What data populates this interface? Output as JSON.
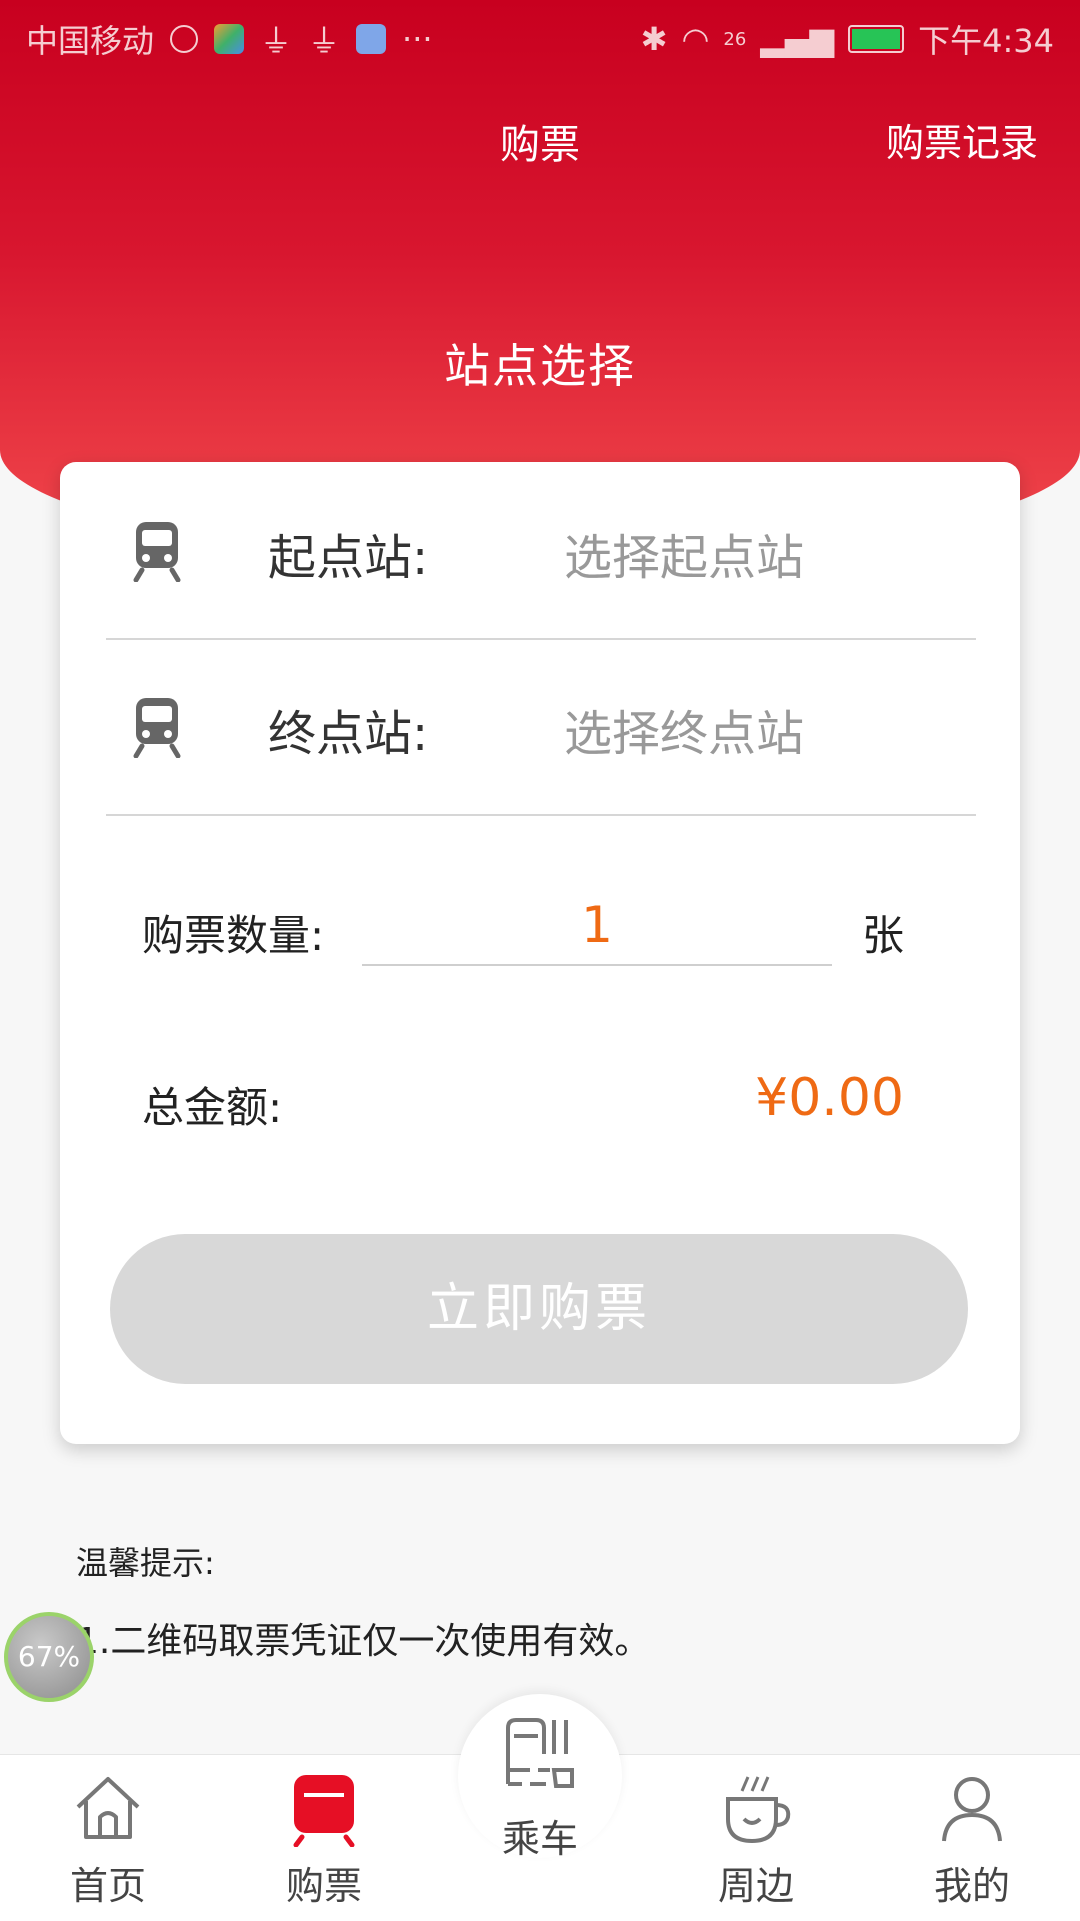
{
  "status_bar": {
    "carrier": "中国移动",
    "more": "···",
    "network": "26",
    "time": "下午4:34"
  },
  "nav": {
    "title": "购票",
    "right_link": "购票记录"
  },
  "section_title": "站点选择",
  "form": {
    "start": {
      "label": "起点站:",
      "placeholder": "选择起点站"
    },
    "end": {
      "label": "终点站:",
      "placeholder": "选择终点站"
    },
    "quantity": {
      "label": "购票数量:",
      "value": "1",
      "unit": "张"
    },
    "total": {
      "label": "总金额:",
      "value": "¥0.00"
    },
    "buy_button": "立即购票"
  },
  "tips": {
    "title": "温馨提示:",
    "lines": [
      "1.二维码取票凭证仅一次使用有效。"
    ]
  },
  "floating_badge": "67%",
  "tabbar": [
    {
      "label": "首页",
      "icon": "home-icon"
    },
    {
      "label": "购票",
      "icon": "ticket-train-icon"
    },
    {
      "label": "乘车",
      "icon": "ride-qr-icon"
    },
    {
      "label": "周边",
      "icon": "coffee-cup-icon"
    },
    {
      "label": "我的",
      "icon": "user-icon"
    }
  ],
  "colors": {
    "brand_red": "#c8001f",
    "accent_orange": "#ef6a14",
    "disabled_gray": "#d8d8d8"
  }
}
